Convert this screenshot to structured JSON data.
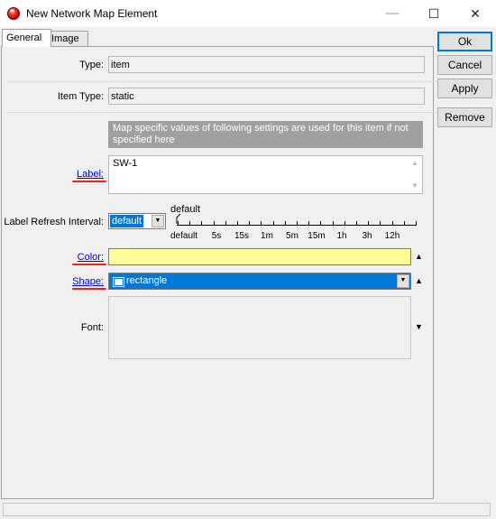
{
  "window": {
    "title": "New Network Map Element",
    "minimize": "—",
    "maximize": "☐",
    "close": "✕"
  },
  "tabs": [
    {
      "label": "General"
    },
    {
      "label": "Image"
    }
  ],
  "fields": {
    "type": {
      "label": "Type:",
      "value": "item"
    },
    "item_type": {
      "label": "Item Type:",
      "value": "static"
    },
    "info": "Map specific values of following settings are used for this item if not specified here",
    "label": {
      "label": "Label:",
      "value": "SW-1"
    },
    "refresh": {
      "label": "Label Refresh Interval:",
      "value": "default",
      "slider_caption": "default",
      "ticks": [
        "default",
        "5s",
        "15s",
        "1m",
        "5m",
        "15m",
        "1h",
        "3h",
        "12h"
      ]
    },
    "color": {
      "label": "Color:",
      "value": "#ffff99"
    },
    "shape": {
      "label": "Shape:",
      "value": "rectangle"
    },
    "font": {
      "label": "Font:"
    }
  },
  "buttons": {
    "ok": "Ok",
    "cancel": "Cancel",
    "apply": "Apply",
    "remove": "Remove"
  }
}
